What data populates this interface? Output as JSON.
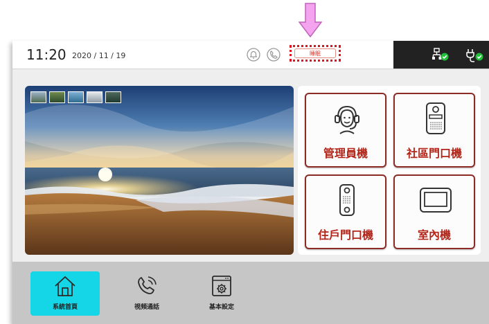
{
  "status_bar": {
    "time": "11:20",
    "date": "2020 / 11 / 19",
    "sleep_button_label": "睡眠"
  },
  "gallery": {
    "thumbnails": [
      "thumbnail-1",
      "thumbnail-2",
      "thumbnail-3",
      "thumbnail-4",
      "thumbnail-5"
    ]
  },
  "tiles": [
    {
      "label": "管理員機",
      "icon": "headset-operator-icon"
    },
    {
      "label": "社區門口機",
      "icon": "door-station-icon"
    },
    {
      "label": "住戶門口機",
      "icon": "doorbell-unit-icon"
    },
    {
      "label": "室內機",
      "icon": "indoor-monitor-icon"
    }
  ],
  "nav": [
    {
      "label": "系統首頁",
      "icon": "home-icon",
      "active": true
    },
    {
      "label": "視頻通話",
      "icon": "phone-call-icon",
      "active": false
    },
    {
      "label": "基本設定",
      "icon": "settings-window-icon",
      "active": false
    }
  ],
  "colors": {
    "accent_active": "#15d6e6",
    "tile_border": "#8c2a26",
    "tile_text": "#b32519",
    "callout_arrow": "#f4a3ee",
    "highlight_box": "#e0141e",
    "status_ok": "#21c13a"
  }
}
